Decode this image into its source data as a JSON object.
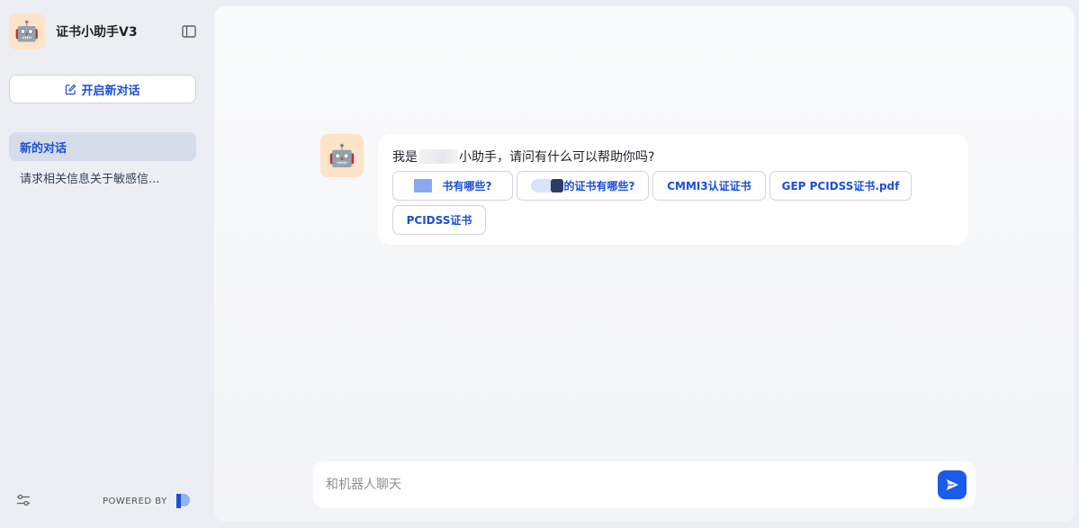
{
  "sidebar": {
    "app_title": "证书小助手V3",
    "app_avatar": "🤖",
    "new_chat_label": "开启新对话",
    "conversations": [
      {
        "label": "新的对话",
        "active": true
      },
      {
        "label": "请求相关信息关于敏感信..."
      }
    ],
    "powered_by": "POWERED BY"
  },
  "chat": {
    "bot_avatar": "🤖",
    "greeting_prefix": "我是",
    "greeting_suffix": "小助手，请问有什么可以帮助你吗?",
    "suggestions": [
      "书有哪些?",
      "的证书有哪些?",
      "CMMI3认证证书",
      "GEP PCIDSS证书.pdf",
      "PCIDSS证书"
    ]
  },
  "composer": {
    "placeholder": "和机器人聊天",
    "value": ""
  },
  "colors": {
    "accent": "#1c4fd6",
    "send_button": "#1c5be8",
    "active_item_bg": "#d6dcea",
    "avatar_bg": "#fde3c8"
  },
  "icons": {
    "sidebar_toggle": "sidebar-toggle-icon",
    "new_chat": "edit-icon",
    "settings": "sliders-icon",
    "send": "send-icon",
    "brand": "brand-logo-icon"
  }
}
